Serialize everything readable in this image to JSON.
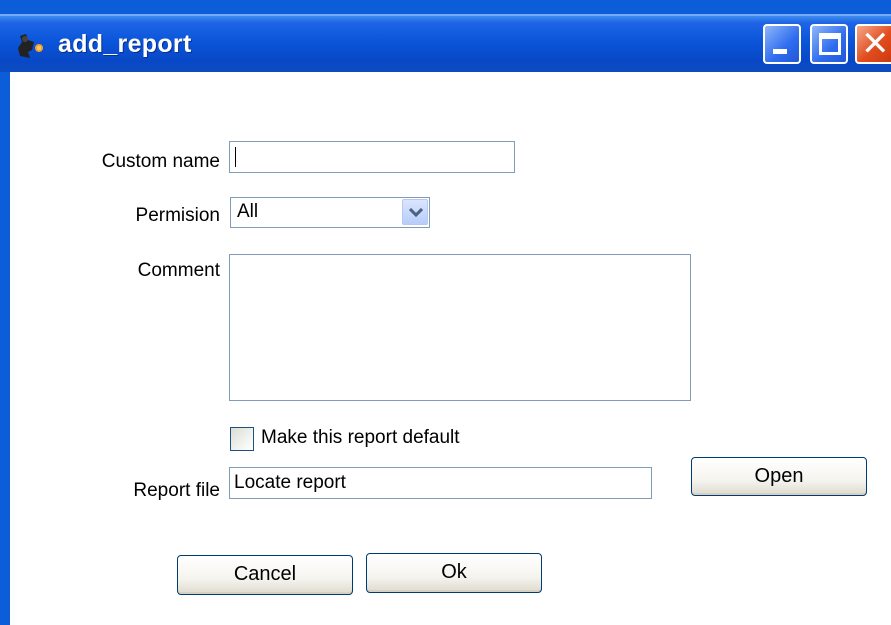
{
  "window": {
    "title": "add_report",
    "icon": "app-icon",
    "controls": [
      "minimize-icon",
      "maximize-icon",
      "close-icon"
    ]
  },
  "form": {
    "custom_name": {
      "label": "Custom name",
      "value": ""
    },
    "permission": {
      "label": "Permision",
      "value": "All"
    },
    "comment": {
      "label": "Comment",
      "value": ""
    },
    "default_checkbox": {
      "label": "Make this report default",
      "checked": false
    },
    "report_file": {
      "label": "Report file",
      "value": "Locate report"
    }
  },
  "buttons": {
    "open": "Open",
    "cancel": "Cancel",
    "ok": "Ok"
  },
  "colors": {
    "titlebar": "#0a55da",
    "close_button": "#e24c1d",
    "input_border": "#7f9db9"
  }
}
